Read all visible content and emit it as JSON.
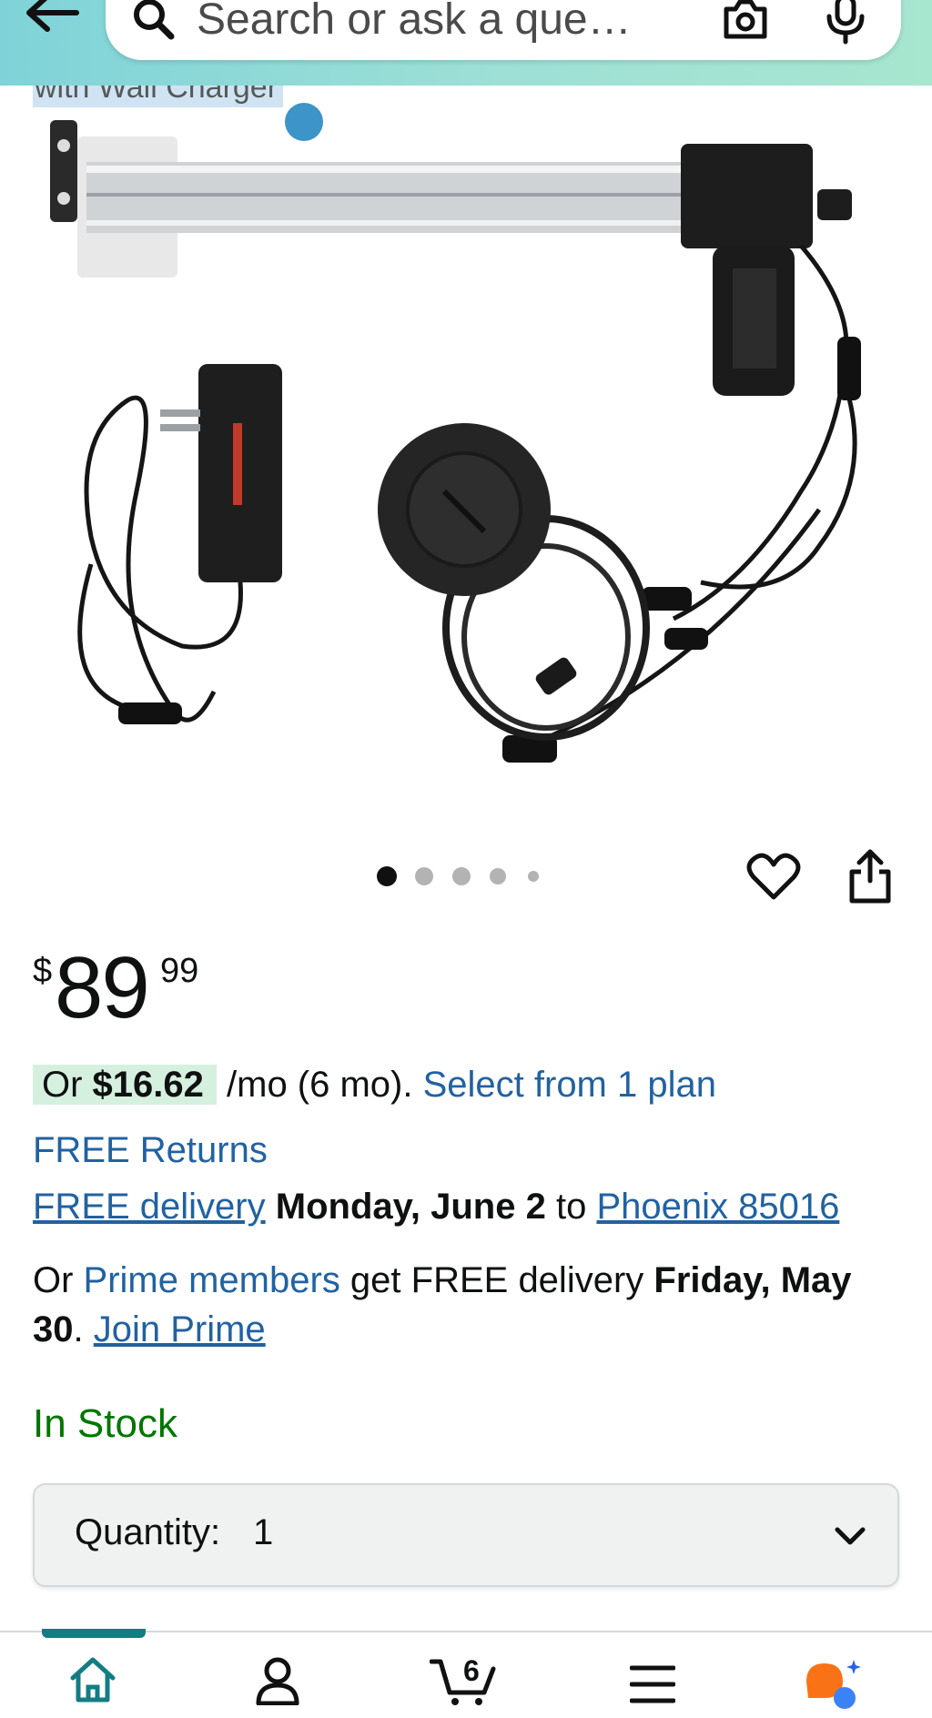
{
  "search": {
    "placeholder": "Search or ask a que…"
  },
  "product": {
    "title_fragment": "with Wall Charger"
  },
  "carousel": {
    "total_images": 5,
    "active_index": 0
  },
  "price": {
    "symbol": "$",
    "whole": "89",
    "fraction": "99"
  },
  "installment": {
    "prefix": "Or ",
    "amount": "$16.62",
    "term": " /mo (6 mo). ",
    "link": "Select from 1 plan"
  },
  "returns": {
    "label": "FREE Returns"
  },
  "delivery": {
    "link": "FREE delivery",
    "date": "Monday, June 2",
    "to": " to ",
    "location": "Phoenix 85016"
  },
  "prime": {
    "prefix": "Or ",
    "members_link": "Prime members",
    "middle": " get FREE delivery ",
    "date": "Friday, May 30",
    "period": ". ",
    "join_link": "Join Prime"
  },
  "stock": {
    "status": "In Stock"
  },
  "quantity": {
    "label": "Quantity:",
    "value": "1"
  },
  "bottom_nav": {
    "cart_count": "6",
    "items": [
      "home-icon",
      "account-icon",
      "cart-icon",
      "menu-icon",
      "rufus-ai-icon"
    ]
  },
  "colors": {
    "header_gradient_start": "#7fd3d8",
    "header_gradient_end": "#a7e6cf",
    "link": "#2162a1",
    "stock_green": "#007600",
    "installment_highlight": "#d6f0e0",
    "nav_active": "#137c83",
    "ai_orange": "#f97316",
    "ai_blue": "#3b82f6"
  }
}
